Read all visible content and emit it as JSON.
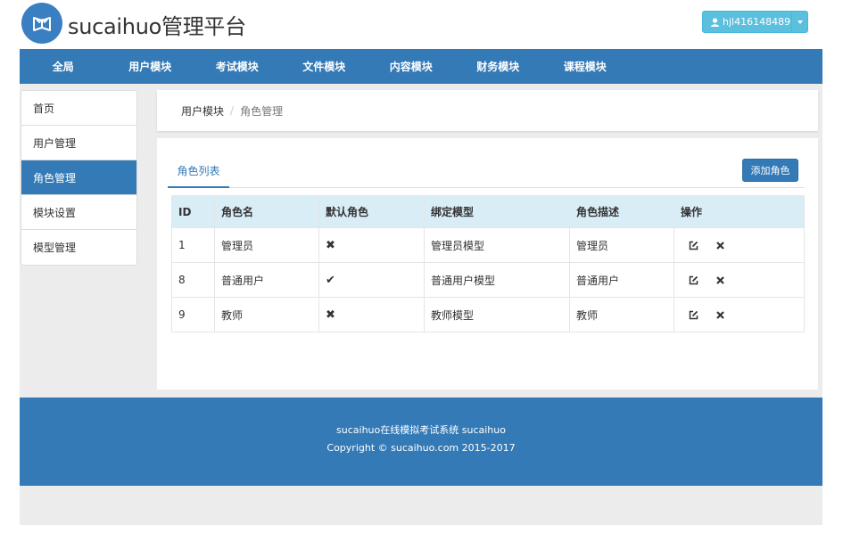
{
  "brand": {
    "title": "sucaihuo管理平台",
    "logo_icon": "book-icon"
  },
  "user": {
    "name": "hjl416148489",
    "icon": "user-icon"
  },
  "nav": {
    "items": [
      {
        "label": "全局"
      },
      {
        "label": "用户模块"
      },
      {
        "label": "考试模块"
      },
      {
        "label": "文件模块"
      },
      {
        "label": "内容模块"
      },
      {
        "label": "财务模块"
      },
      {
        "label": "课程模块"
      }
    ]
  },
  "sidebar": {
    "items": [
      {
        "label": "首页"
      },
      {
        "label": "用户管理"
      },
      {
        "label": "角色管理"
      },
      {
        "label": "模块设置"
      },
      {
        "label": "模型管理"
      }
    ]
  },
  "breadcrumb": {
    "parent": "用户模块",
    "separator": "/",
    "current": "角色管理"
  },
  "main": {
    "tab_label": "角色列表",
    "add_button": "添加角色",
    "columns": [
      "ID",
      "角色名",
      "默认角色",
      "绑定模型",
      "角色描述",
      "操作"
    ],
    "rows": [
      {
        "id": "1",
        "name": "管理员",
        "default": "✖",
        "model": "管理员模型",
        "desc": "管理员"
      },
      {
        "id": "8",
        "name": "普通用户",
        "default": "✔",
        "model": "普通用户模型",
        "desc": "普通用户"
      },
      {
        "id": "9",
        "name": "教师",
        "default": "✖",
        "model": "教师模型",
        "desc": "教师"
      }
    ],
    "edit_icon": "edit-icon",
    "delete_icon": "delete-icon"
  },
  "footer": {
    "line1": "sucaihuo在线模拟考试系统 sucaihuo",
    "line2": "Copyright © sucaihuo.com 2015-2017"
  },
  "colors": {
    "primary": "#337ab7",
    "info": "#5bc0de",
    "table_header": "#d9edf7"
  }
}
